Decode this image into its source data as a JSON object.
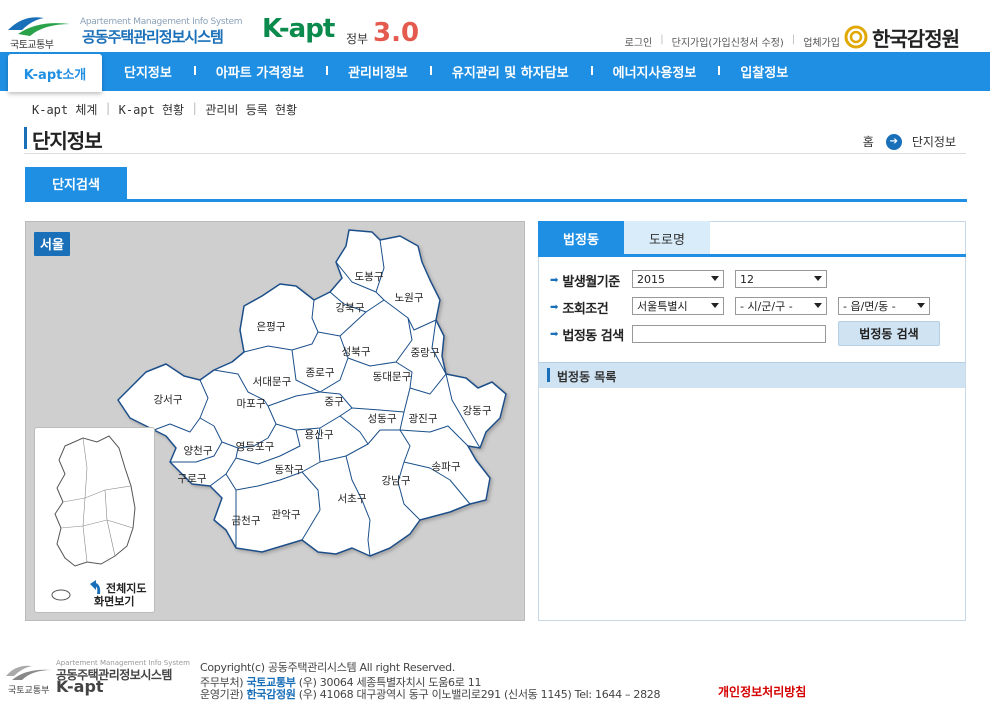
{
  "header": {
    "molit": "국토교통부",
    "site_en": "Apartement Management Info System",
    "site_kr": "공동주택관리정보시스템",
    "site_kapt": "K-apt",
    "gov_label": "정부",
    "gov_version": "3.0",
    "util_links": [
      "로그인",
      "단지가입(가입신청서 수정)",
      "업체가입"
    ],
    "reb": "한국감정원"
  },
  "nav": {
    "home": "K-apt소개",
    "items": [
      "단지정보",
      "아파트 가격정보",
      "관리비정보",
      "유지관리 및 하자담보",
      "에너지사용정보",
      "입찰정보"
    ]
  },
  "subnav": [
    "K-apt 체계",
    "K-apt 현황",
    "관리비 등록 현황"
  ],
  "page": {
    "title": "단지정보",
    "crumb_home": "홈",
    "crumb_current": "단지정보",
    "search_tab": "단지검색"
  },
  "map": {
    "region_label": "서울",
    "districts": [
      "도봉구",
      "노원구",
      "강북구",
      "은평구",
      "성북구",
      "중랑구",
      "종로구",
      "동대문구",
      "서대문구",
      "마포구",
      "중구",
      "강서구",
      "성동구",
      "광진구",
      "강동구",
      "용산구",
      "양천구",
      "영등포구",
      "구로구",
      "동작구",
      "송파구",
      "강남구",
      "서초구",
      "관악구",
      "금천구"
    ],
    "minimap_link": [
      "전체지도",
      "화면보기"
    ]
  },
  "search": {
    "tabs": [
      "법정동",
      "도로명"
    ],
    "row1_label": "발생월기준",
    "year": "2015",
    "month": "12",
    "row2_label": "조회조건",
    "sido": "서울특별시",
    "sigungu": "- 시/군/구 -",
    "eupmyeon": "- 읍/면/동 -",
    "row3_label": "법정동 검색",
    "search_button": "법정동 검색",
    "list_title": "법정동 목록"
  },
  "footer": {
    "en": "Apartement Management Info System",
    "kr": "공동주택관리정보시스템",
    "kapt": "K-apt",
    "molit": "국토교통부",
    "copyright": "Copyright(c) 공동주택관리시스템 All right Reserved.",
    "line2_prefix": "주무부처)",
    "line2_org": "국토교통부",
    "line2_rest": "(우) 30064  세종특별자치시 도움6로 11",
    "line3_prefix": "운영기관)",
    "line3_org": "한국감정원",
    "line3_rest": "(우) 41068  대구광역시 동구 이노밸리로291 (신서동 1145) Tel: 1644 – 2828",
    "privacy": "개인정보처리방침"
  },
  "colors": {
    "nav_blue": "#1f8fe3",
    "brand_blue": "#1a6fb9",
    "kapt_green": "#0a8a4c",
    "privacy_red": "#d40000"
  }
}
